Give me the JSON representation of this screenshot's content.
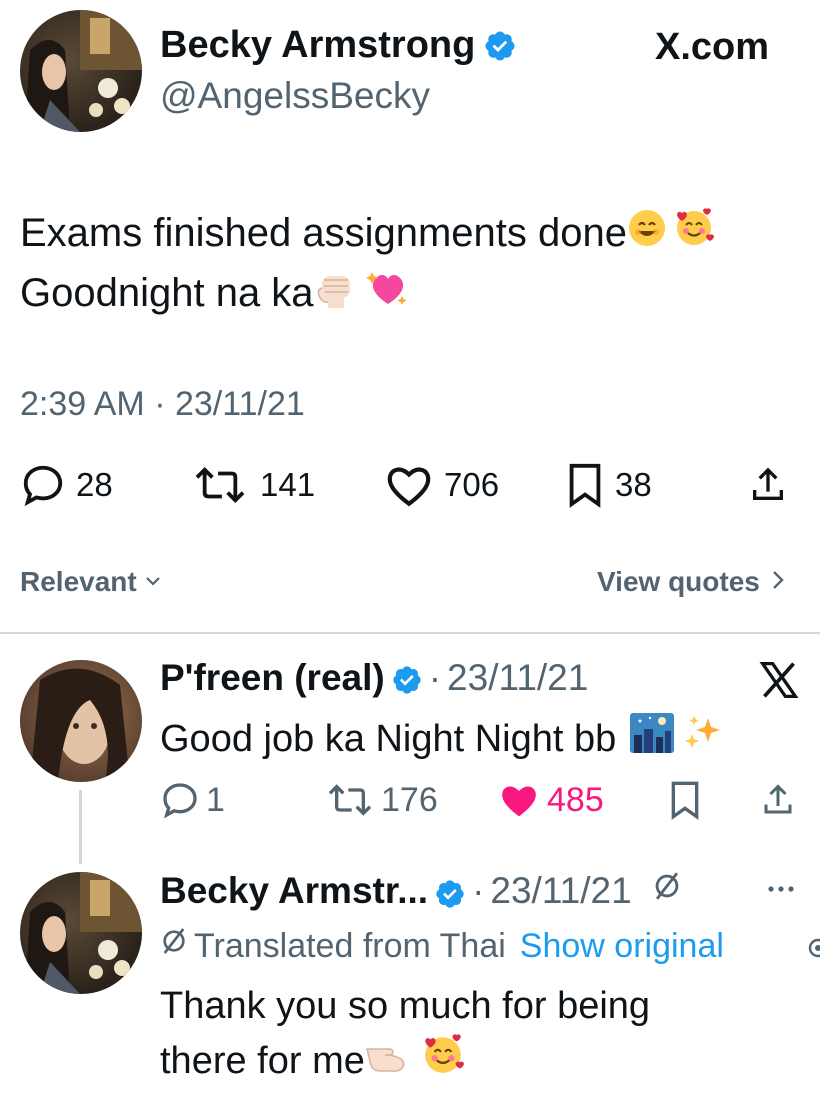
{
  "main_tweet": {
    "author_name": "Becky Armstrong",
    "handle": "@AngelssBecky",
    "site_label": "X.com",
    "text_line1": "Exams finished assignments done",
    "text_line2": "Goodnight na ka",
    "timestamp": "2:39 AM · 23/11/21",
    "stats": {
      "replies": "28",
      "reposts": "141",
      "likes": "706",
      "bookmarks": "38"
    }
  },
  "sort": {
    "label": "Relevant",
    "view_quotes": "View quotes"
  },
  "reply1": {
    "author_name": "P'freen (real)",
    "date": "23/11/21",
    "text": "Good job ka Night Night bb",
    "stats": {
      "replies": "1",
      "reposts": "176",
      "likes": "485"
    }
  },
  "reply2": {
    "author_name": "Becky Armstr...",
    "date": "23/11/21",
    "translated_label": "Translated from Thai",
    "show_original": "Show original",
    "text_line1": "Thank you so much for being",
    "text_line2": "there for me"
  },
  "colors": {
    "accent": "#1d9bf0",
    "like_active": "#f91880",
    "text_secondary": "#536471",
    "divider": "#cfd9de"
  },
  "icons": [
    "verified-badge-icon",
    "reply-icon",
    "repost-icon",
    "like-icon",
    "bookmark-icon",
    "share-icon",
    "x-logo-icon",
    "chevron-down-icon",
    "chevron-right-icon",
    "translate-icon",
    "more-icon"
  ]
}
